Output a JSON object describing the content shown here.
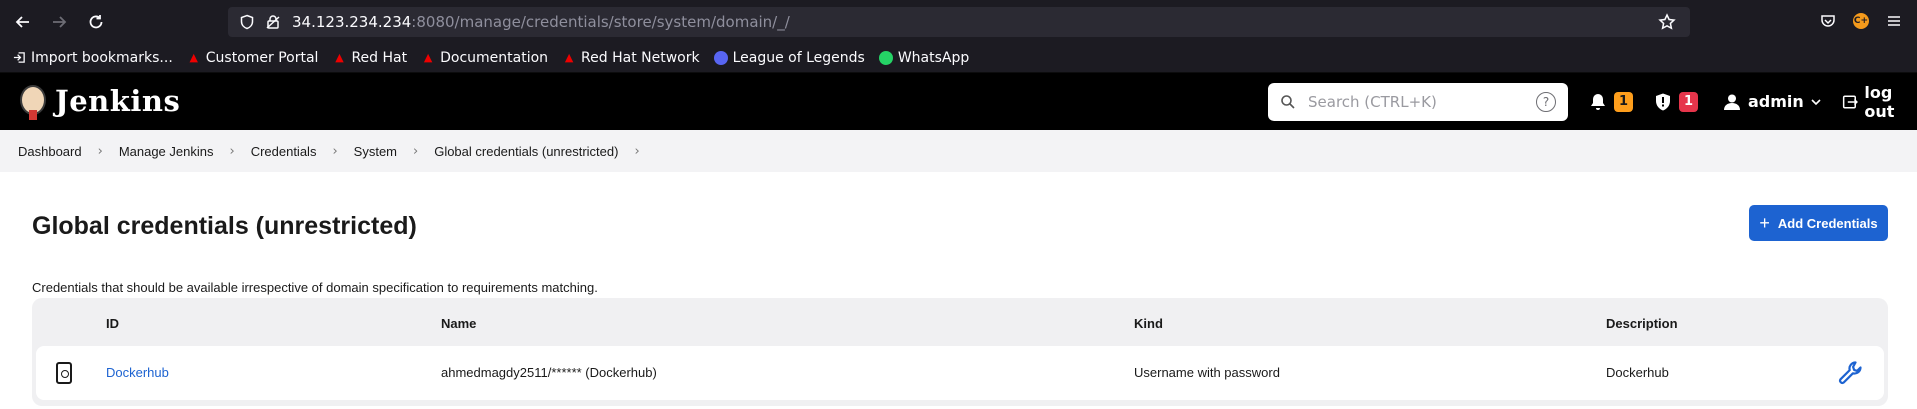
{
  "browser": {
    "url_host": "34.123.234.234",
    "url_rest": ":8080/manage/credentials/store/system/domain/_/",
    "ext_badge": "C+",
    "bookmarks": [
      {
        "label": "Import bookmarks...",
        "icon": "import-icon"
      },
      {
        "label": "Customer Portal",
        "icon": "redhat-icon"
      },
      {
        "label": "Red Hat",
        "icon": "redhat-icon"
      },
      {
        "label": "Documentation",
        "icon": "redhat-icon"
      },
      {
        "label": "Red Hat Network",
        "icon": "redhat-icon"
      },
      {
        "label": "League of Legends",
        "icon": "discord-icon"
      },
      {
        "label": "WhatsApp",
        "icon": "whatsapp-icon"
      }
    ]
  },
  "header": {
    "brand": "Jenkins",
    "search_placeholder": "Search (CTRL+K)",
    "help_glyph": "?",
    "notifications_count": "1",
    "security_count": "1",
    "user": "admin",
    "logout": "log out"
  },
  "breadcrumbs": [
    "Dashboard",
    "Manage Jenkins",
    "Credentials",
    "System",
    "Global credentials (unrestricted)"
  ],
  "main": {
    "title": "Global credentials (unrestricted)",
    "add_button": "Add Credentials",
    "description": "Credentials that should be available irrespective of domain specification to requirements matching.",
    "columns": [
      "ID",
      "Name",
      "Kind",
      "Description"
    ],
    "rows": [
      {
        "id": "Dockerhub",
        "name": "ahmedmagdy2511/****** (Dockerhub)",
        "kind": "Username with password",
        "description": "Dockerhub"
      }
    ]
  },
  "colors": {
    "accent": "#1d63d1",
    "warn": "#fe9e1c",
    "danger": "#e6354b",
    "header_bg": "#000000"
  }
}
